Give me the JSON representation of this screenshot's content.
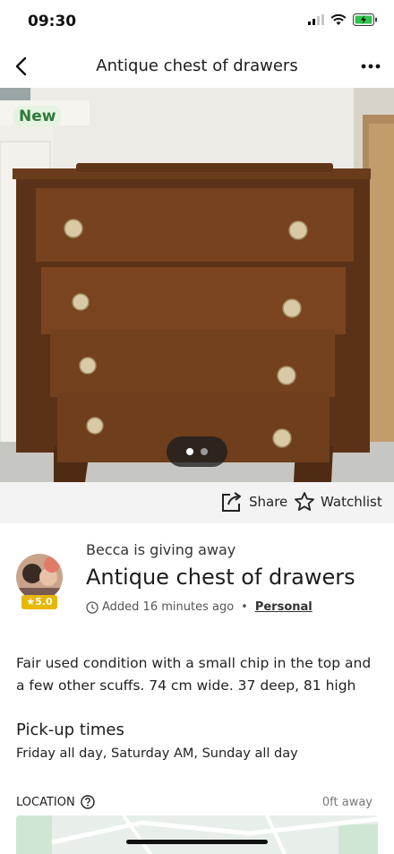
{
  "status_bar": {
    "time": "09:30"
  },
  "nav": {
    "title": "Antique chest of drawers"
  },
  "photo": {
    "badge": "New",
    "pages": 2,
    "current_page": 1
  },
  "actions": {
    "share_label": "Share",
    "watchlist_label": "Watchlist"
  },
  "listing": {
    "giver_text": "Becca is giving away",
    "title": "Antique chest of drawers",
    "rating": "5.0",
    "added": "Added 16 minutes ago",
    "separator": "•",
    "type": "Personal",
    "description": "Fair used condition with a small chip in the top and a few other scuffs. 74 cm wide. 37 deep, 81 high"
  },
  "pickup": {
    "heading": "Pick-up times",
    "times": "Friday all day, Saturday AM, Sunday all day"
  },
  "location": {
    "label": "LOCATION",
    "distance": "0ft away"
  },
  "colors": {
    "accent_green": "#2f7a3a",
    "rating_gold": "#e6b800"
  }
}
